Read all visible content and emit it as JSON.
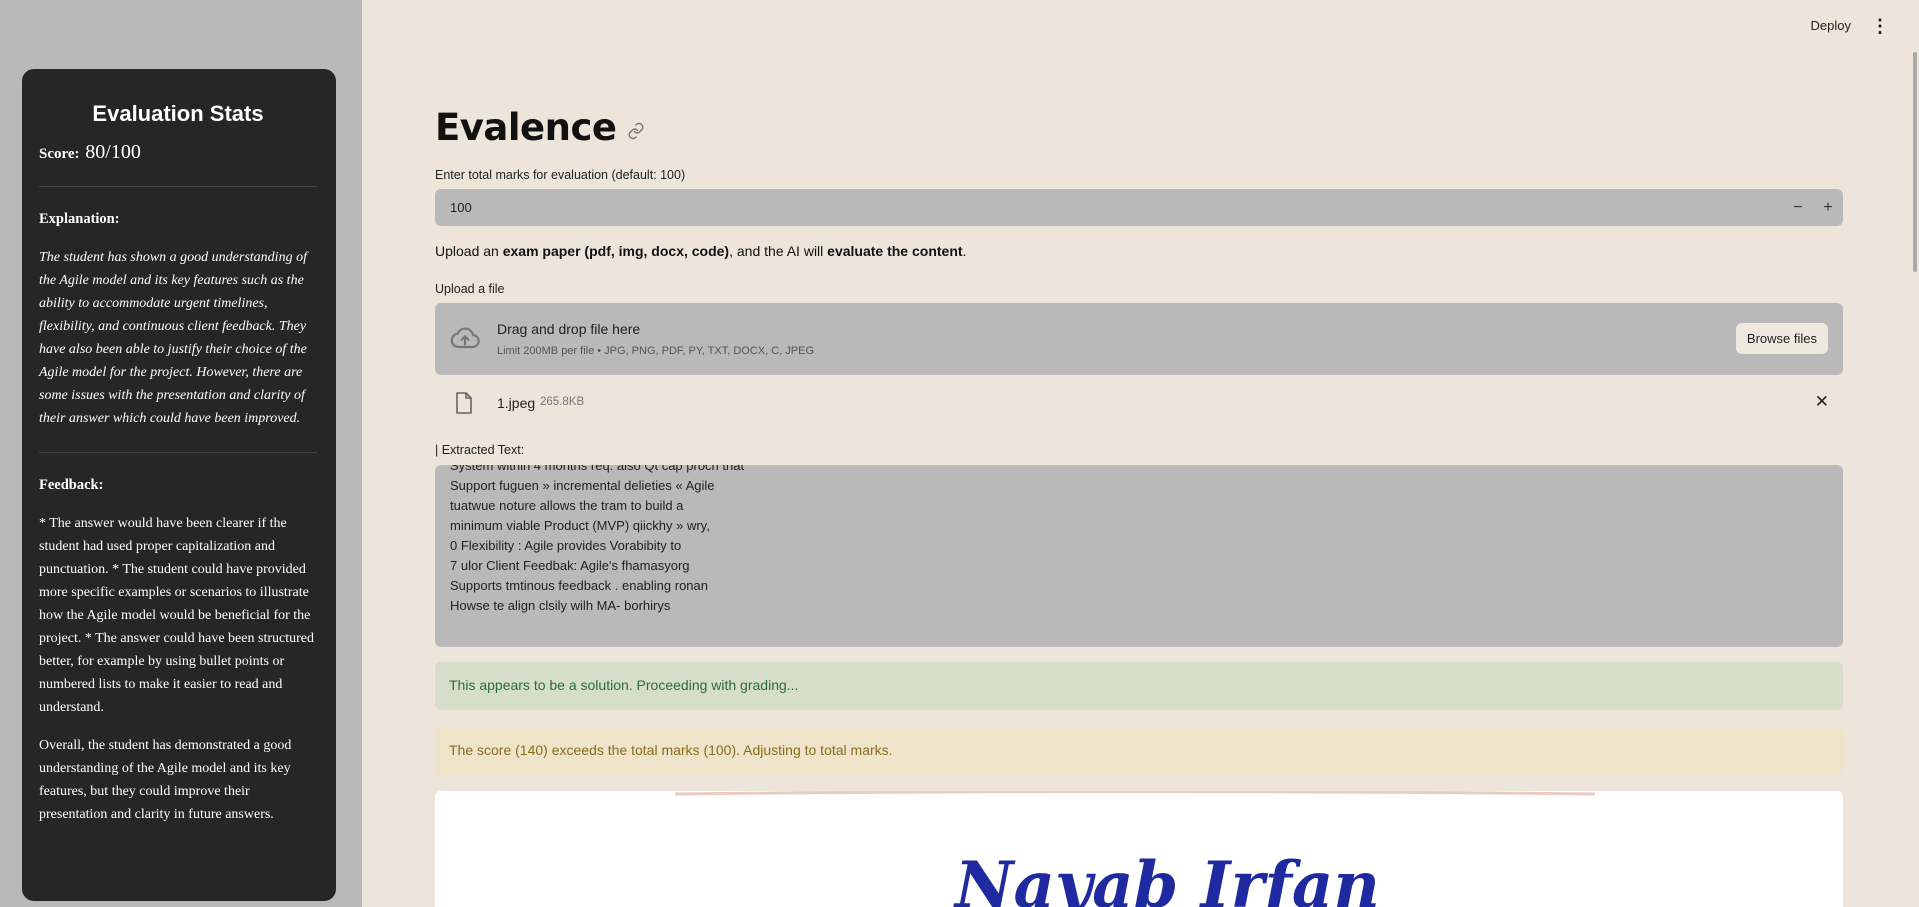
{
  "sidebar": {
    "title": "Evaluation Stats",
    "score_label": "Score:",
    "score_value": "80/100",
    "explanation_label": "Explanation:",
    "explanation_text": "The student has shown a good understanding of the Agile model and its key features such as the ability to accommodate urgent timelines, flexibility, and continuous client feedback. They have also been able to justify their choice of the Agile model for the project. However, there are some issues with the presentation and clarity of their answer which could have been improved.",
    "feedback_label": "Feedback:",
    "feedback_text_1": "* The answer would have been clearer if the student had used proper capitalization and punctuation. * The student could have provided more specific examples or scenarios to illustrate how the Agile model would be beneficial for the project. * The answer could have been structured better, for example by using bullet points or numbered lists to make it easier to read and understand.",
    "feedback_text_2": "Overall, the student has demonstrated a good understanding of the Agile model and its key features, but they could improve their presentation and clarity in future answers."
  },
  "header": {
    "deploy_label": "Deploy",
    "menu_icon": "kebab-menu-icon"
  },
  "main": {
    "title": "Evalence",
    "marks_label": "Enter total marks for evaluation (default: 100)",
    "marks_value": "100",
    "minus_label": "−",
    "plus_label": "+",
    "upload_desc_1": "Upload an ",
    "upload_desc_bold_1": "exam paper (pdf, img, docx, code)",
    "upload_desc_2": ", and the AI will ",
    "upload_desc_bold_2": "evaluate the content",
    "upload_desc_3": ".",
    "upload_label": "Upload a file",
    "dropzone_title": "Drag and drop file here",
    "dropzone_limit": "Limit 200MB per file • JPG, PNG, PDF, PY, TXT, DOCX, C, JPEG",
    "browse_label": "Browse files",
    "file_name": "1.jpeg",
    "file_size": "265.8KB",
    "remove_label": "✕",
    "extracted_label": "| Extracted Text:",
    "extracted_text": "System within 4 months req. also Qt cap proch that\nSupport fuguen » incremental delieties « Agile\ntuatwue noture allows the tram to build a\nminimum viable Product (MVP) qiickhy » wry,\n0 Flexibility : Agile provides Vorabibity to\n7 ulor Client Feedbak: Agile's fhamasyorg\nSupports tmtinous feedback . enabling ronan\nHowse te align clsily wilh MA- borhirys",
    "success_message": "This appears to be a solution. Proceeding with grading...",
    "warning_message": "The score (140) exceeds the total marks (100). Adjusting to total marks.",
    "image_handwriting": "Nayab Irfan"
  },
  "colors": {
    "background": "#ede5da",
    "sidebar_bg": "#b9b9b9",
    "card_bg": "#262626",
    "input_bg": "#b9b9b9",
    "success_bg": "#d6dec9",
    "success_text": "#2a6e3a",
    "warning_bg": "#efe3c9",
    "warning_text": "#8a6d1a",
    "ink_blue": "#1f2aa0"
  }
}
